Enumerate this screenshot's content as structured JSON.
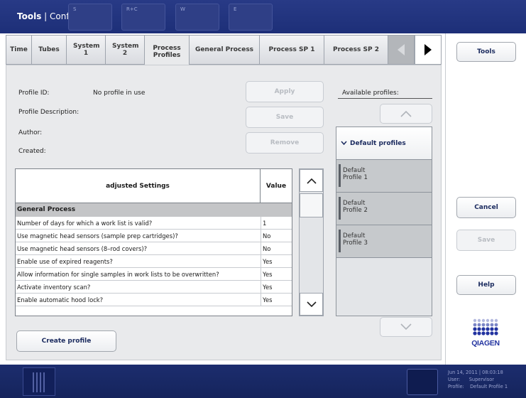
{
  "window": {
    "title_bold": "Tools",
    "title_rest": " | Configuration"
  },
  "tabs": [
    {
      "label": "Time"
    },
    {
      "label": "Tubes"
    },
    {
      "label": "System 1"
    },
    {
      "label": "System 2"
    },
    {
      "label": "Process Profiles",
      "active": true
    },
    {
      "label": "General Process"
    },
    {
      "label": "Process SP 1"
    },
    {
      "label": "Process SP 2"
    }
  ],
  "form": {
    "profile_id_label": "Profile ID:",
    "profile_id_value": "No profile in use",
    "description_label": "Profile Description:",
    "author_label": "Author:",
    "created_label": "Created:",
    "apply": "Apply",
    "save": "Save",
    "remove": "Remove",
    "available_label": "Available profiles:",
    "create_profile": "Create profile"
  },
  "table": {
    "headers": [
      "adjusted Settings",
      "Value"
    ],
    "group": "General Process",
    "rows": [
      [
        "Number of days for which a work list is valid?",
        "1"
      ],
      [
        "Use magnetic head sensors (sample prep cartridges)?",
        "No"
      ],
      [
        "Use magnetic head sensors (8–rod covers)?",
        "No"
      ],
      [
        "Enable use of expired reagents?",
        "Yes"
      ],
      [
        "Allow information for single samples in work lists to be overwritten?",
        "Yes"
      ],
      [
        "Activate inventory scan?",
        "Yes"
      ],
      [
        "Enable automatic hood lock?",
        "Yes"
      ]
    ]
  },
  "profiles": {
    "group": "Default profiles",
    "items": [
      "Default\nProfile 1",
      "Default\nProfile 2",
      "Default\nProfile 3"
    ]
  },
  "sidebar": {
    "tools": "Tools",
    "cancel": "Cancel",
    "save": "Save",
    "help": "Help",
    "logo": "QIAGEN"
  },
  "bottombar": {
    "cells": [
      "S",
      "R+C",
      "W",
      "E"
    ],
    "status_lines": [
      "Jun 14, 2011 | 08:03:18",
      "User:      Supervisor",
      "Profile:    Default Profile 1"
    ]
  },
  "colors": {
    "title_bar": "#1d2f78",
    "accent_text": "#1a2a5e",
    "qiagen_blue": "#2233a0"
  }
}
